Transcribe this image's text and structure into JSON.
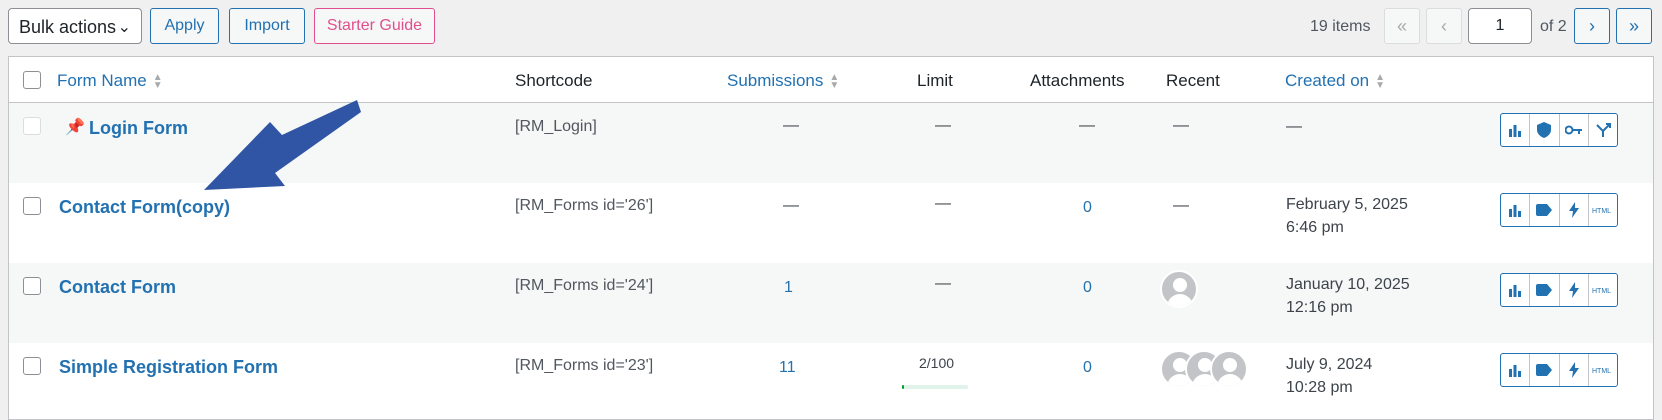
{
  "toolbar": {
    "bulk_actions": "Bulk actions",
    "apply": "Apply",
    "import": "Import",
    "starter_guide": "Starter Guide"
  },
  "pagination": {
    "items": "19 items",
    "first": "«",
    "prev": "‹",
    "current_page": "1",
    "of": "of 2",
    "next": "›",
    "last": "»"
  },
  "columns": {
    "form_name": "Form Name",
    "shortcode": "Shortcode",
    "submissions": "Submissions",
    "limit": "Limit",
    "attachments": "Attachments",
    "recent": "Recent",
    "created_on": "Created on"
  },
  "rows": [
    {
      "name": "Login Form",
      "shortcode": "[RM_Login]",
      "submissions": "—",
      "limit": "—",
      "attachments": "—",
      "recent": "—",
      "created_date": "—",
      "created_time": ""
    },
    {
      "name": "Contact Form(copy)",
      "shortcode": "[RM_Forms id='26']",
      "submissions": "—",
      "limit": "—",
      "attachments": "0",
      "recent": "—",
      "created_date": "February 5, 2025",
      "created_time": "6:46 pm"
    },
    {
      "name": "Contact Form",
      "shortcode": "[RM_Forms id='24']",
      "submissions": "1",
      "limit": "—",
      "attachments": "0",
      "recent": "",
      "created_date": "January 10, 2025",
      "created_time": "12:16 pm"
    },
    {
      "name": "Simple Registration Form",
      "shortcode": "[RM_Forms id='23']",
      "submissions": "11",
      "limit": "2/100",
      "limit_fraction": 0.02,
      "attachments": "0",
      "recent": "",
      "created_date": "July 9, 2024",
      "created_time": "10:28 pm"
    }
  ],
  "colors": {
    "accent": "#2271b1",
    "guide": "#e0508e",
    "arrow": "#2f55a4"
  }
}
